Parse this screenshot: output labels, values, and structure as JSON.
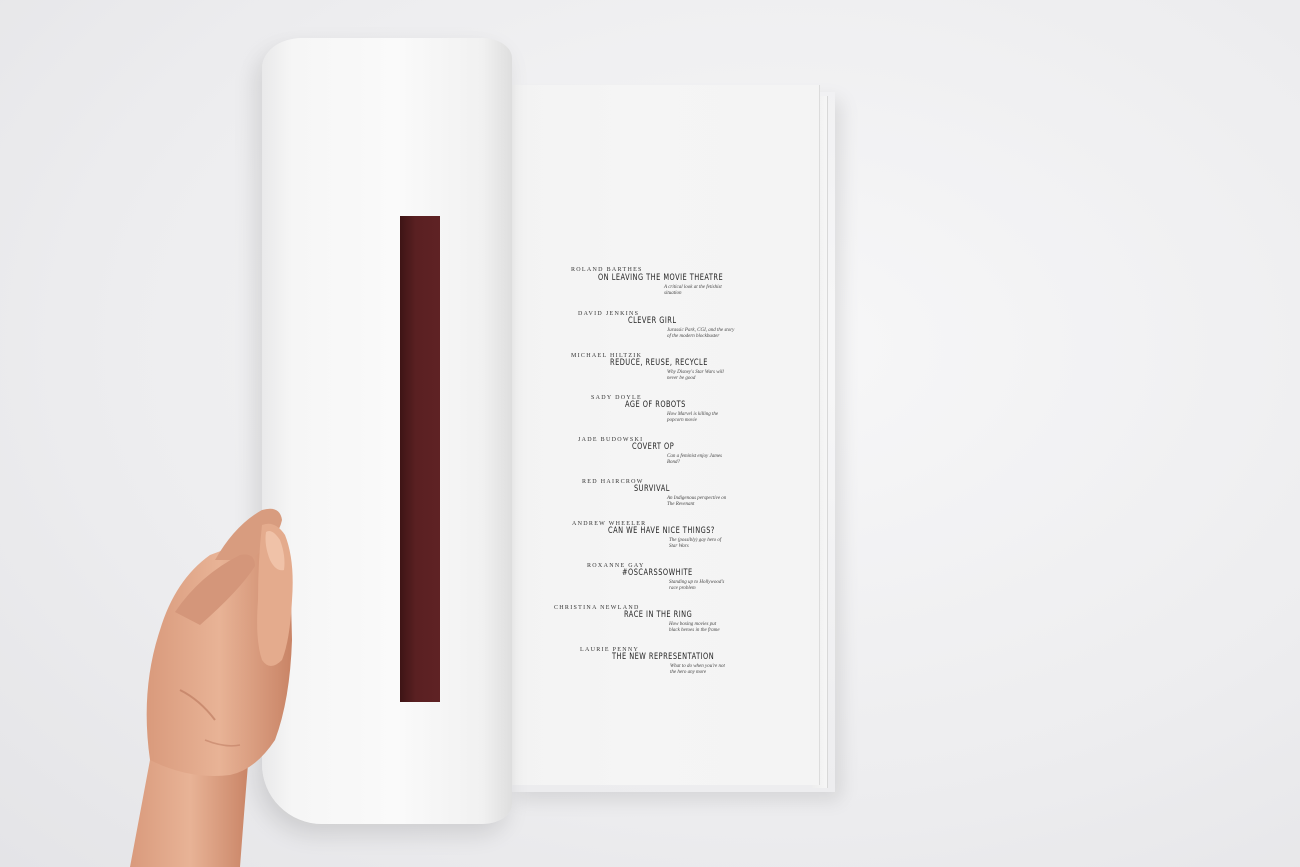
{
  "magazine": {
    "accent_color": "#5a2022",
    "toc": [
      {
        "author": "Roland Barthes",
        "title": "On Leaving the Movie Theatre",
        "subtitle": "A critical look at the fetishist situation"
      },
      {
        "author": "David Jenkins",
        "title": "Clever Girl",
        "subtitle": "Jurassic Park, CGI, and the story of the modern blockbuster"
      },
      {
        "author": "Michael Hiltzik",
        "title": "Reduce, Reuse, Recycle",
        "subtitle": "Why Disney's Star Wars will never be good"
      },
      {
        "author": "Sady Doyle",
        "title": "Age of Robots",
        "subtitle": "How Marvel is killing the popcorn movie"
      },
      {
        "author": "Jade Budowski",
        "title": "Covert Op",
        "subtitle": "Can a feminist enjoy James Bond?"
      },
      {
        "author": "Red Haircrow",
        "title": "Survival",
        "subtitle": "An Indigenous perspective on The Revenant"
      },
      {
        "author": "Andrew Wheeler",
        "title": "Can We Have Nice Things?",
        "subtitle": "The (possibly) gay hero of Star Wars"
      },
      {
        "author": "Roxanne Gay",
        "title": "#OscarsSoWhite",
        "subtitle": "Standing up to Hollywood's race problem"
      },
      {
        "author": "Christina Newland",
        "title": "Race in the Ring",
        "subtitle": "How boxing movies put black heroes in the frame"
      },
      {
        "author": "Laurie Penny",
        "title": "The New Representation",
        "subtitle": "What to do when you're not the hero any more"
      }
    ]
  }
}
